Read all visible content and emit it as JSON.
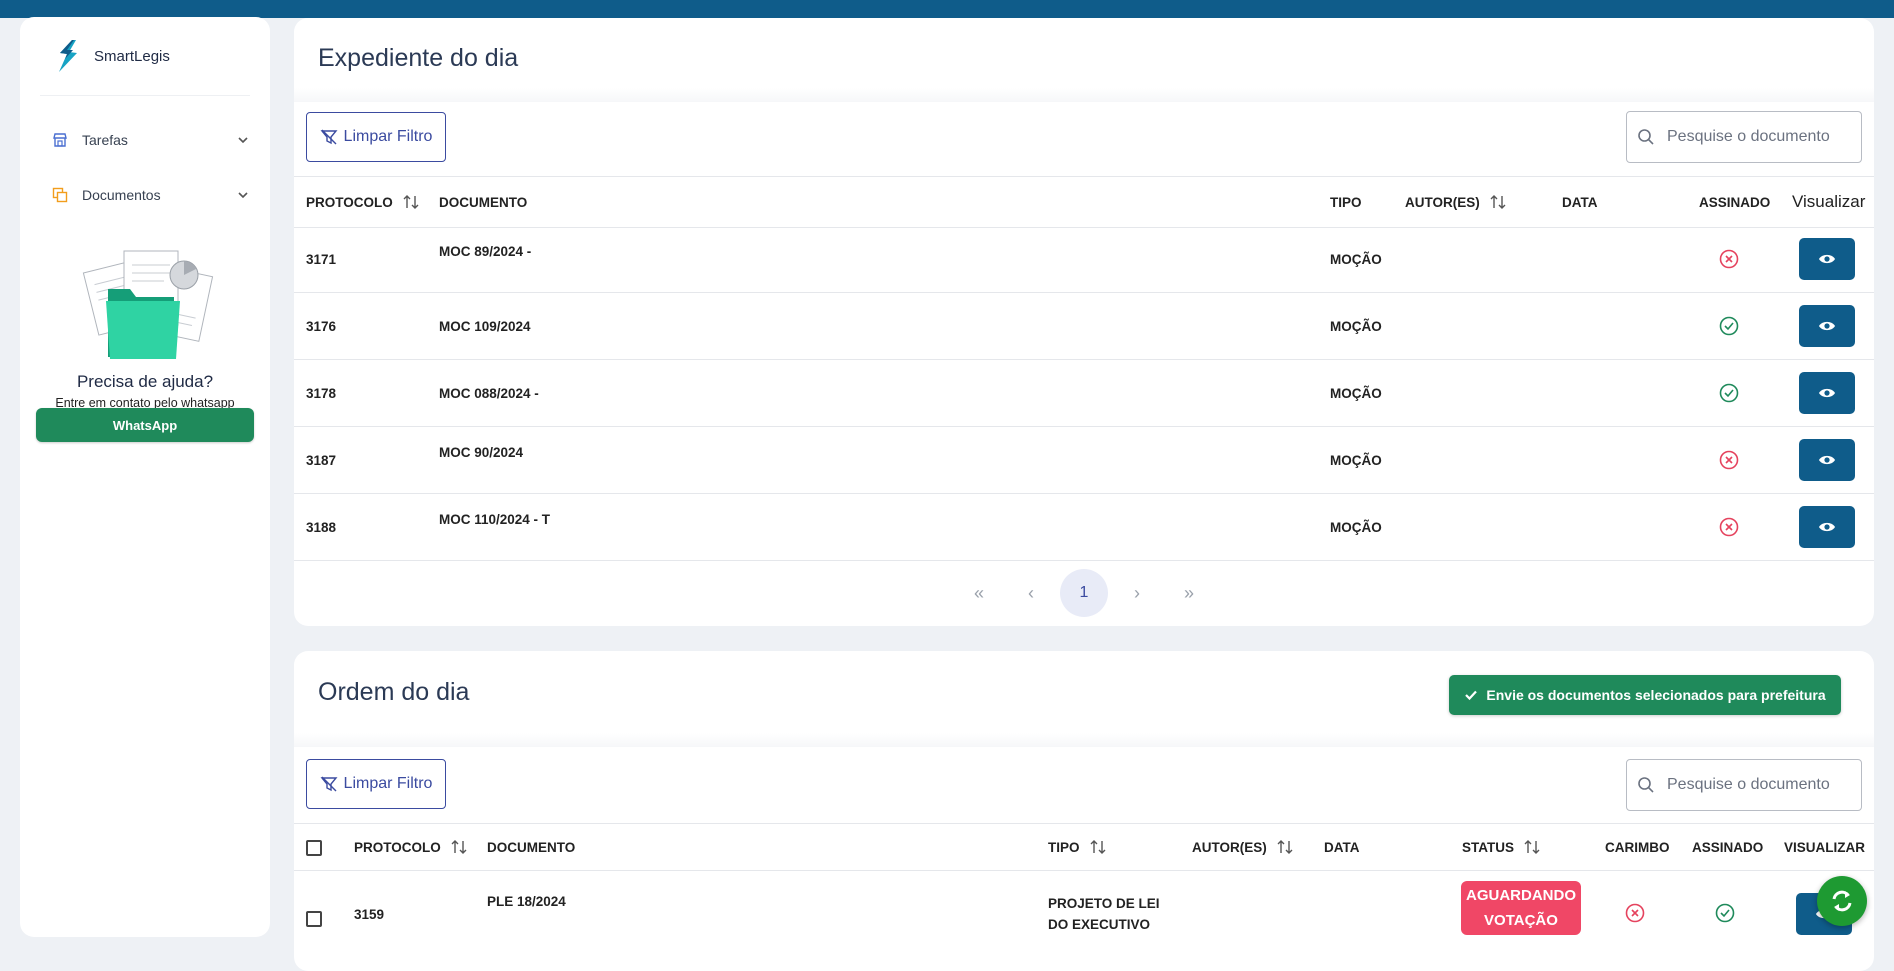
{
  "app": {
    "brand": "SmartLegis"
  },
  "sidebar": {
    "items": [
      {
        "label": "Tarefas",
        "icon": "store-icon"
      },
      {
        "label": "Documentos",
        "icon": "documents-icon"
      }
    ],
    "help": {
      "title": "Precisa de ajuda?",
      "subtitle": "Entre em contato pelo whatsapp",
      "button": "WhatsApp"
    }
  },
  "expediente": {
    "title": "Expediente do dia",
    "filter_label": "Limpar Filtro",
    "search_placeholder": "Pesquise o documento",
    "columns": [
      "PROTOCOLO",
      "DOCUMENTO",
      "TIPO",
      "AUTOR(ES)",
      "DATA",
      "ASSINADO",
      "Visualizar"
    ],
    "rows": [
      {
        "protocolo": "3171",
        "documento": "MOC 89/2024 -",
        "tipo": "MOÇÃO",
        "assinado": false
      },
      {
        "protocolo": "3176",
        "documento": "MOC 109/2024",
        "tipo": "MOÇÃO",
        "assinado": true
      },
      {
        "protocolo": "3178",
        "documento": "MOC 088/2024 -",
        "tipo": "MOÇÃO",
        "assinado": true
      },
      {
        "protocolo": "3187",
        "documento": "MOC 90/2024",
        "tipo": "MOÇÃO",
        "assinado": false
      },
      {
        "protocolo": "3188",
        "documento": "MOC 110/2024 - T",
        "tipo": "MOÇÃO",
        "assinado": false
      }
    ],
    "pagination": {
      "current_page": "1"
    }
  },
  "ordem": {
    "title": "Ordem do dia",
    "send_button": "Envie os documentos selecionados para prefeitura",
    "filter_label": "Limpar Filtro",
    "search_placeholder": "Pesquise o documento",
    "columns": [
      "PROTOCOLO",
      "DOCUMENTO",
      "TIPO",
      "AUTOR(ES)",
      "DATA",
      "STATUS",
      "CARIMBO",
      "ASSINADO",
      "VISUALIZAR"
    ],
    "rows": [
      {
        "protocolo": "3159",
        "documento": "PLE 18/2024",
        "tipo": "PROJETO DE LEI DO EXECUTIVO",
        "status": "AGUARDANDO VOTAÇÃO",
        "carimbo": false,
        "assinado": true
      }
    ]
  },
  "colors": {
    "primary": "#0f5c8a",
    "accent": "#3b4ba0",
    "success": "#1f8a5b",
    "danger": "#e5435e",
    "badge": "#f04766"
  }
}
